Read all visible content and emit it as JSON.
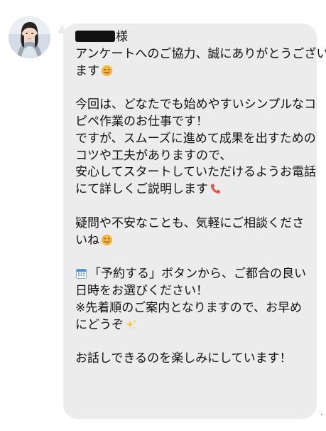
{
  "message": {
    "salutation_suffix": "様",
    "lines": [
      "アンケートへのご協力、誠にありがとうござい",
      "ます",
      "今回は、どなたでも始めやすいシンプルなコ",
      "ピペ作業のお仕事です！",
      "ですが、スムーズに進めて成果を出すための",
      "コツや工夫がありますので、",
      "安心してスタートしていただけるようお電話",
      "にて詳しくご説明します",
      "疑問や不安なことも、気軽にご相談くださ",
      "いね",
      "「予約する」ボタンから、ご都合の良い",
      "日時をお選びください！",
      "※先着順のご案内となりますので、お早め",
      "にどうぞ",
      "お話しできるのを楽しみにしています！"
    ]
  },
  "icons": {
    "avatar": "avatar-portrait",
    "smile1": "smiling-face-icon",
    "phone": "telephone-receiver-icon",
    "smile2": "smiling-face-icon",
    "calendar": "calendar-icon",
    "sparkles": "sparkles-icon"
  },
  "colors": {
    "bubble": "#ececec",
    "text": "#111111",
    "phone": "#e0524c",
    "smile": "#f4b63b",
    "calendar": "#4a8fd8",
    "sparkles": "#f5c842"
  }
}
